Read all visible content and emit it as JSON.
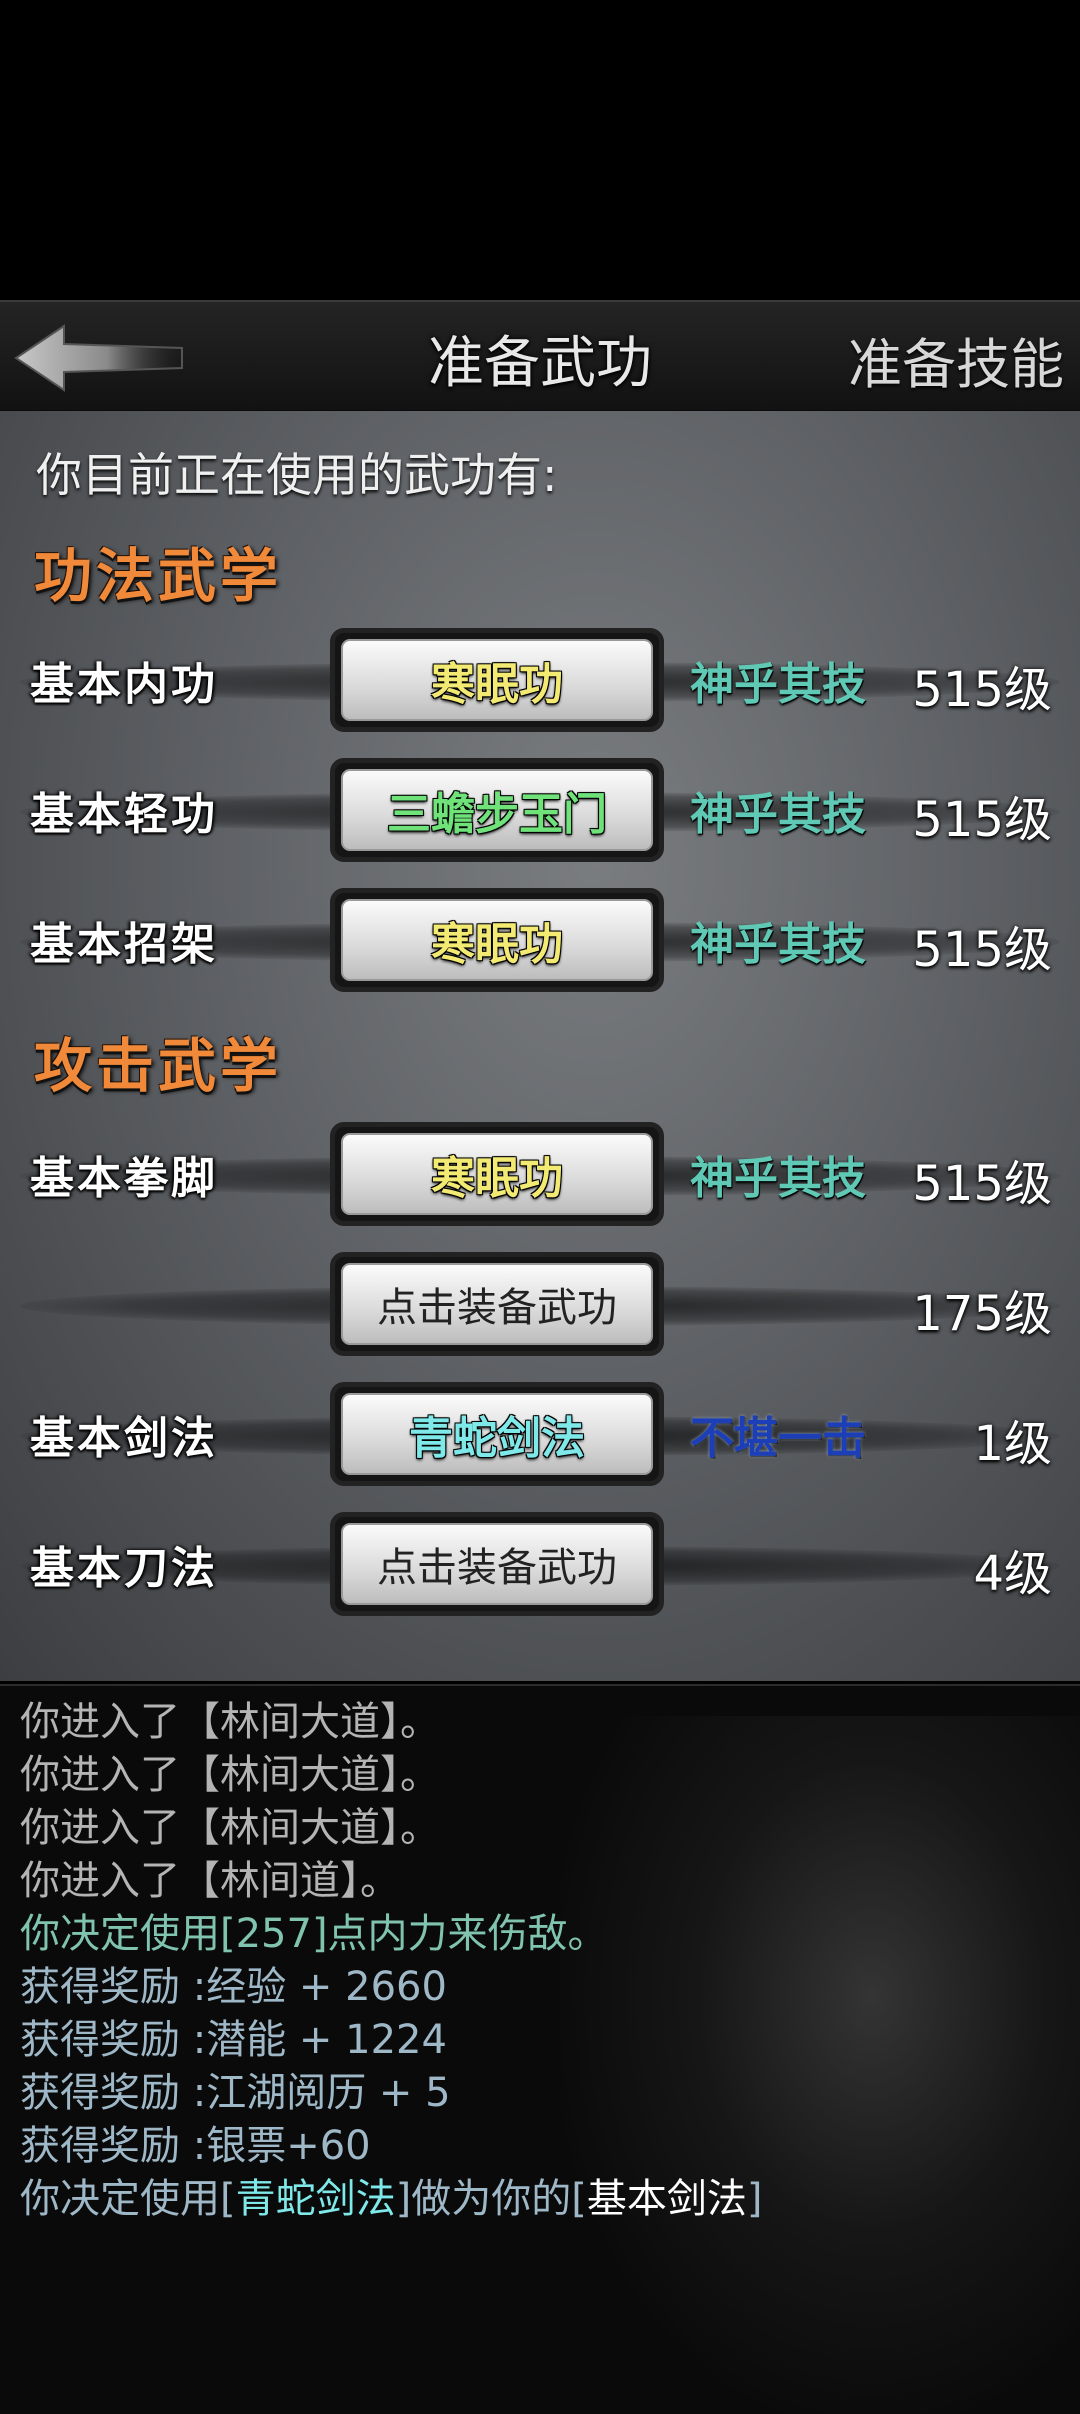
{
  "header": {
    "title": "准备武功",
    "right_button": "准备技能"
  },
  "intro": "你目前正在使用的武功有:",
  "sections": [
    {
      "title": "功法武学",
      "rows": [
        {
          "category": "基本内功",
          "equipped": "寒眠功",
          "rank": "神乎其技",
          "level": "515级"
        },
        {
          "category": "基本轻功",
          "equipped": "三蟾步玉门",
          "rank": "神乎其技",
          "level": "515级"
        },
        {
          "category": "基本招架",
          "equipped": "寒眠功",
          "rank": "神乎其技",
          "level": "515级"
        }
      ]
    },
    {
      "title": "攻击武学",
      "rows": [
        {
          "category": "基本拳脚",
          "equipped": "寒眠功",
          "rank": "神乎其技",
          "level": "515级"
        },
        {
          "category": "",
          "equipped": "点击装备武功",
          "rank": "",
          "level": "175级"
        },
        {
          "category": "基本剑法",
          "equipped": "青蛇剑法",
          "rank": "不堪一击",
          "level": "1级"
        },
        {
          "category": "基本刀法",
          "equipped": "点击装备武功",
          "rank": "",
          "level": "4级"
        }
      ]
    }
  ],
  "log": {
    "lines": [
      "你进入了【林间大道】。",
      "你进入了【林间大道】。",
      "你进入了【林间大道】。",
      "你进入了【林间道】。",
      "你决定使用[257]点内力来伤敌。",
      "获得奖励 :经验 + 2660",
      "获得奖励 :潜能 + 1224",
      "获得奖励 :江湖阅历 + 5",
      "获得奖励 :银票+60"
    ],
    "final": {
      "prefix": "你决定使用[",
      "skill": "青蛇剑法",
      "middle": "]做为你的[",
      "slot": "基本剑法",
      "suffix": "]"
    }
  },
  "colors": {
    "section_title": "#f08a3a",
    "rank_teal": "#5fc9b5",
    "rank_blue": "#1c3fb8",
    "skill_yellow": "#f3ea74",
    "skill_green": "#6fe37a",
    "skill_cyan": "#7fe9ea"
  }
}
